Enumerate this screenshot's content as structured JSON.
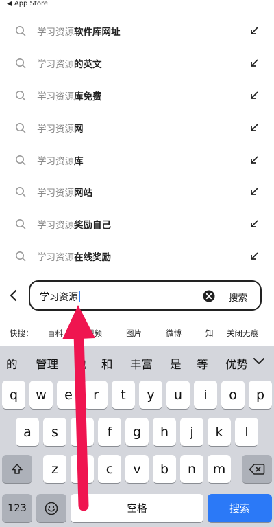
{
  "status_bar": {
    "back_label": "◀ App Store"
  },
  "suggestions": [
    {
      "query": "学习资源",
      "rest": "软件库网址"
    },
    {
      "query": "学习资源",
      "rest": "的英文"
    },
    {
      "query": "学习资源",
      "rest": "库免费"
    },
    {
      "query": "学习资源",
      "rest": "网"
    },
    {
      "query": "学习资源",
      "rest": "库"
    },
    {
      "query": "学习资源",
      "rest": "网站"
    },
    {
      "query": "学习资源",
      "rest": "奖励自己"
    },
    {
      "query": "学习资源",
      "rest": "在线奖励"
    }
  ],
  "search": {
    "value": "学习资源",
    "button_label": "搜索"
  },
  "quick_links": {
    "label": "快搜：",
    "items": [
      "百科",
      "视频",
      "图片",
      "微博",
      "知",
      "关闭无痕"
    ]
  },
  "keyboard": {
    "candidates": [
      "的",
      "管理",
      "也",
      "和",
      "丰富",
      "是",
      "等",
      "优势"
    ],
    "row1": [
      "q",
      "w",
      "e",
      "r",
      "t",
      "y",
      "u",
      "i",
      "o",
      "p"
    ],
    "row2": [
      "a",
      "s",
      "d",
      "f",
      "g",
      "h",
      "j",
      "k",
      "l"
    ],
    "row3": [
      "z",
      "x",
      "c",
      "v",
      "b",
      "n",
      "m"
    ],
    "numbers_label": "123",
    "space_label": "空格",
    "search_label": "搜索"
  },
  "colors": {
    "accent": "#2b79f7",
    "annotation_arrow": "#ef1550"
  }
}
